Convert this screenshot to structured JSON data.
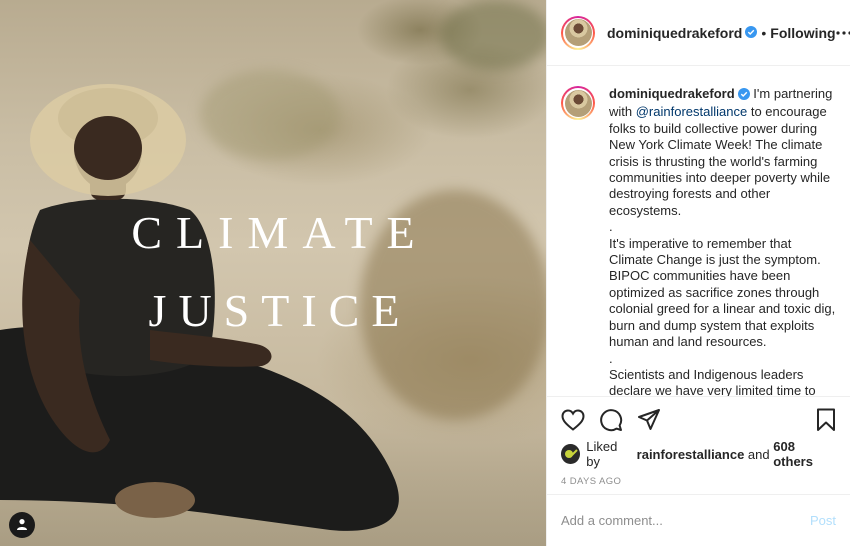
{
  "media": {
    "headline_line1": "CLIMATE",
    "headline_line2": "JUSTICE",
    "user_tag_icon": "person-icon"
  },
  "header": {
    "username": "dominiquedrakeford",
    "separator": "•",
    "follow_state": "Following",
    "more_icon": "more-horizontal-icon",
    "verified_icon": "verified-badge-icon"
  },
  "caption": {
    "author": "dominiquedrakeford",
    "text_pre": " I'm partnering with ",
    "mention": "@rainforestalliance",
    "text_post": " to encourage folks to build collective power during New York Climate Week!  The climate crisis is thrusting the world's farming communities into deeper poverty while destroying forests and other ecosystems.",
    "dot1": ".",
    "para2": "It's imperative to remember that Climate Change is just the symptom. BIPOC communities have been optimized as sacrifice zones through colonial greed for a linear and toxic dig, burn and dump system that exploits human and land resources.",
    "dot2": ".",
    "para3": "Scientists and Indigenous leaders declare we have very limited time to"
  },
  "actions": {
    "like_icon": "heart-icon",
    "comment_icon": "comment-icon",
    "share_icon": "share-icon",
    "save_icon": "bookmark-icon"
  },
  "likes": {
    "prefix": "Liked by ",
    "liker": "rainforestalliance",
    "middle": " and ",
    "others": "608 others"
  },
  "timestamp": "4 DAYS AGO",
  "comment": {
    "placeholder": "Add a comment...",
    "post_label": "Post"
  },
  "colors": {
    "verified_blue": "#3897f0",
    "mention_blue": "#00376b",
    "post_disabled": "#b2dffc",
    "meta_gray": "#8e8e8e"
  }
}
